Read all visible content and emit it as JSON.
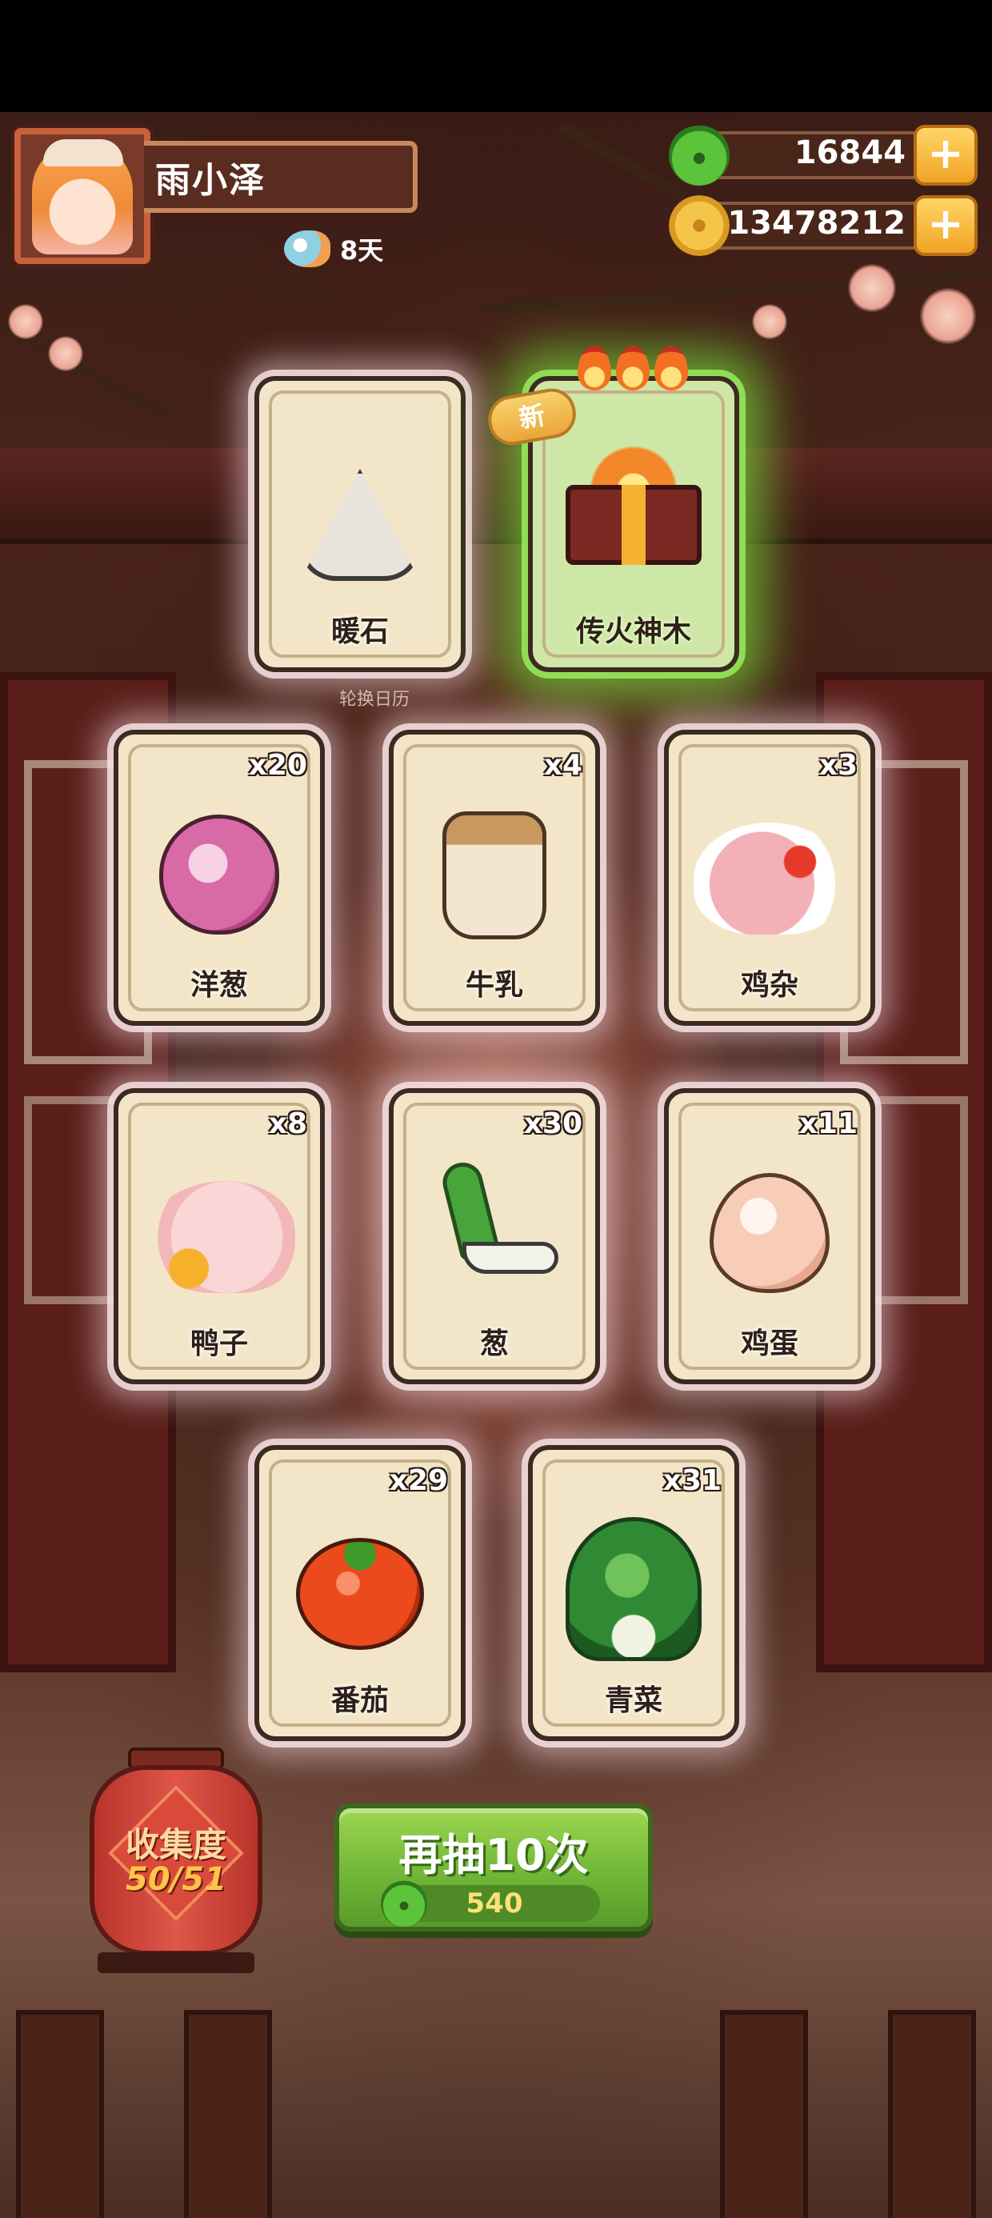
{
  "player": {
    "name": "雨小泽",
    "days": "8天",
    "avatar_icon": "chef-girl-avatar-icon"
  },
  "currencies": [
    {
      "icon": "jade-icon",
      "value": "16844",
      "add_label": "+"
    },
    {
      "icon": "coin-icon",
      "value": "13478212",
      "add_label": "+"
    }
  ],
  "caption": "轮换日历",
  "new_badge": "新",
  "cards": [
    {
      "name": "暖石",
      "count": "",
      "icon": "warm-stone-icon",
      "highlight": false
    },
    {
      "name": "传火神木",
      "count": "",
      "icon": "fire-chest-icon",
      "highlight": true
    },
    {
      "name": "洋葱",
      "count": "x20",
      "icon": "onion-icon"
    },
    {
      "name": "牛乳",
      "count": "x4",
      "icon": "milk-jar-icon"
    },
    {
      "name": "鸡杂",
      "count": "x3",
      "icon": "chicken-giblets-icon"
    },
    {
      "name": "鸭子",
      "count": "x8",
      "icon": "duck-icon"
    },
    {
      "name": "葱",
      "count": "x30",
      "icon": "scallion-icon"
    },
    {
      "name": "鸡蛋",
      "count": "x11",
      "icon": "egg-icon"
    },
    {
      "name": "番茄",
      "count": "x29",
      "icon": "tomato-icon"
    },
    {
      "name": "青菜",
      "count": "x31",
      "icon": "bok-choy-icon"
    }
  ],
  "collection": {
    "label": "收集度",
    "progress": "50/51"
  },
  "draw_button": {
    "label": "再抽10次",
    "cost": "540",
    "cost_icon": "jade-icon"
  }
}
